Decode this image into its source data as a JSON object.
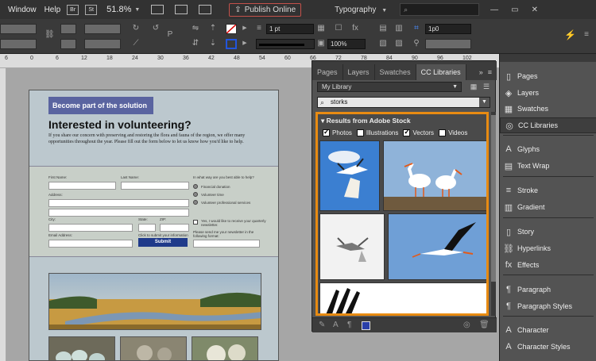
{
  "menubar": {
    "items": [
      "Window",
      "Help"
    ],
    "bridge_label": "Br",
    "stock_label": "St",
    "zoom": "51.8%",
    "publish_label": "Publish Online",
    "workspace": "Typography",
    "search_placeholder": ""
  },
  "controlbar": {
    "stroke_weight": "1 pt",
    "opacity": "100%",
    "tint": "1p0"
  },
  "ruler": {
    "labels": [
      "6",
      "0",
      "6",
      "12",
      "18",
      "24",
      "30",
      "36",
      "42",
      "48",
      "54",
      "60",
      "66",
      "72",
      "78",
      "84",
      "90",
      "96",
      "102"
    ]
  },
  "document": {
    "banner": "Become part of the solution",
    "headline": "Interested in volunteering?",
    "intro": "If you share our concern with preserving and restoring the flora and fauna of the region, we offer many opportunities throughout the year. Please fill out the form below to let us know how you'd like to help.",
    "form": {
      "first_name": "First Name:",
      "last_name": "Last Name:",
      "address": "Address:",
      "city": "City:",
      "state": "State:",
      "zip": "ZIP:",
      "email": "Email Address:",
      "help_question": "In what way are you best able to help?",
      "options": [
        "Financial donation",
        "Volunteer time",
        "Volunteer professional services"
      ],
      "newsletter": "Yes, I would like to receive your quarterly newsletter.",
      "format": "Please send me your newsletter in the following format:",
      "click_submit": "Click to submit your information",
      "submit": "Submit"
    }
  },
  "cc_panel": {
    "tabs": [
      "Pages",
      "Layers",
      "Swatches",
      "CC Libraries"
    ],
    "more": "»",
    "library": "My Library",
    "search": "storks",
    "results_title": "Results from Adobe Stock",
    "filters": [
      {
        "label": "Photos",
        "checked": true
      },
      {
        "label": "Illustrations",
        "checked": false
      },
      {
        "label": "Vectors",
        "checked": true
      },
      {
        "label": "Videos",
        "checked": false
      }
    ]
  },
  "dock": {
    "items": [
      {
        "label": "Pages",
        "icon": "pages-icon"
      },
      {
        "label": "Layers",
        "icon": "layers-icon"
      },
      {
        "label": "Swatches",
        "icon": "swatches-icon"
      },
      {
        "label": "CC Libraries",
        "icon": "cc-libraries-icon"
      },
      {
        "label": "Glyphs",
        "icon": "glyphs-icon"
      },
      {
        "label": "Text Wrap",
        "icon": "text-wrap-icon"
      },
      {
        "label": "Stroke",
        "icon": "stroke-icon"
      },
      {
        "label": "Gradient",
        "icon": "gradient-icon"
      },
      {
        "label": "Story",
        "icon": "story-icon"
      },
      {
        "label": "Hyperlinks",
        "icon": "hyperlinks-icon"
      },
      {
        "label": "Effects",
        "icon": "effects-icon"
      },
      {
        "label": "Paragraph",
        "icon": "paragraph-icon"
      },
      {
        "label": "Paragraph Styles",
        "icon": "paragraph-styles-icon"
      },
      {
        "label": "Character",
        "icon": "character-icon"
      },
      {
        "label": "Character Styles",
        "icon": "character-styles-icon"
      }
    ]
  },
  "colors": {
    "accent_orange": "#e88b12",
    "banner_blue": "#5a64a0",
    "submit_blue": "#1f3a8a",
    "publish_border": "#c4514a"
  }
}
